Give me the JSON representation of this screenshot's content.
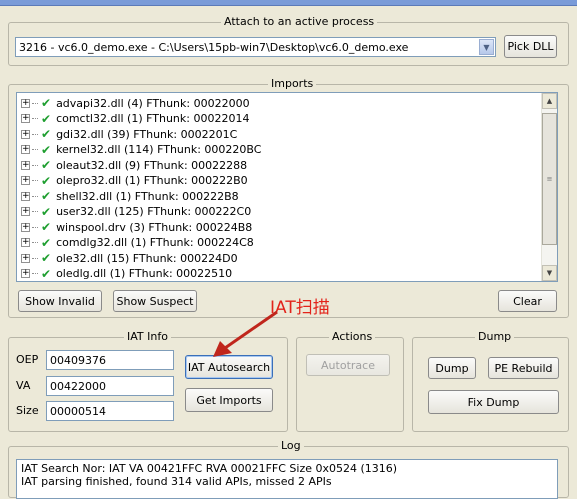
{
  "attach": {
    "title": "Attach to an active process",
    "process_value": "3216 - vc6.0_demo.exe - C:\\Users\\15pb-win7\\Desktop\\vc6.0_demo.exe",
    "pick_dll": "Pick DLL"
  },
  "imports": {
    "title": "Imports",
    "items": [
      "advapi32.dll (4) FThunk: 00022000",
      "comctl32.dll (1) FThunk: 00022014",
      "gdi32.dll (39) FThunk: 0002201C",
      "kernel32.dll (114) FThunk: 000220BC",
      "oleaut32.dll (9) FThunk: 00022288",
      "olepro32.dll (1) FThunk: 000222B0",
      "shell32.dll (1) FThunk: 000222B8",
      "user32.dll (125) FThunk: 000222C0",
      "winspool.drv (3) FThunk: 000224B8",
      "comdlg32.dll (1) FThunk: 000224C8",
      "ole32.dll (15) FThunk: 000224D0",
      "oledlg.dll (1) FThunk: 00022510"
    ],
    "show_invalid": "Show Invalid",
    "show_suspect": "Show Suspect",
    "clear": "Clear"
  },
  "iat_info": {
    "title": "IAT Info",
    "oep_label": "OEP",
    "oep_value": "00409376",
    "va_label": "VA",
    "va_value": "00422000",
    "size_label": "Size",
    "size_value": "00000514",
    "iat_autosearch": "IAT Autosearch",
    "get_imports": "Get Imports"
  },
  "actions": {
    "title": "Actions",
    "autotrace": "Autotrace"
  },
  "dump": {
    "title": "Dump",
    "dump": "Dump",
    "pe_rebuild": "PE Rebuild",
    "fix_dump": "Fix Dump"
  },
  "log": {
    "title": "Log",
    "lines": [
      "IAT Search Nor: IAT VA 00421FFC RVA 00021FFC Size 0x0524 (1316)",
      "IAT parsing finished, found 314 valid APIs, missed 2 APIs"
    ]
  },
  "annotation": {
    "text": "IAT扫描",
    "color": "#e2231a"
  }
}
